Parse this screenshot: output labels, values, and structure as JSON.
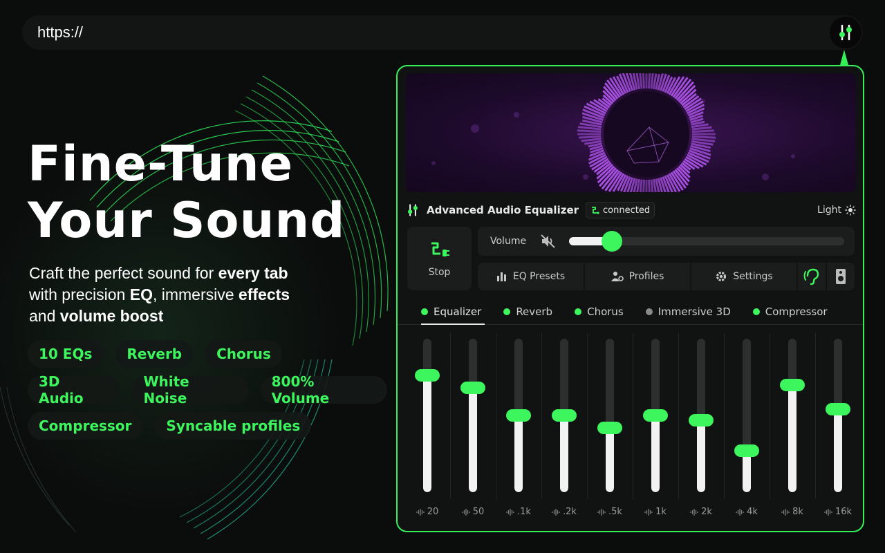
{
  "browser": {
    "url": "https://"
  },
  "hero": {
    "title_line1": "Fine-Tune",
    "title_line2": "Your Sound",
    "sub_1": "Craft the perfect sound for ",
    "sub_2": "every tab",
    "sub_3": "with precision ",
    "sub_4": "EQ",
    "sub_5": ", immersive ",
    "sub_6": "effects",
    "sub_7": "and ",
    "sub_8": "volume boost"
  },
  "features": {
    "row1": [
      "10 EQs",
      "Reverb",
      "Chorus"
    ],
    "row2": [
      "3D Audio",
      "White Noise",
      "800% Volume"
    ],
    "row3": [
      "Compressor",
      "Syncable profiles"
    ]
  },
  "panel": {
    "app_title": "Advanced Audio Equalizer",
    "status": "connected",
    "theme_label": "Light",
    "stop_label": "Stop",
    "volume_label": "Volume",
    "volume_level": 0.155,
    "nav": {
      "eq_presets": "EQ Presets",
      "profiles": "Profiles",
      "settings": "Settings"
    },
    "tabs": [
      {
        "label": "Equalizer",
        "enabled": true,
        "active": true
      },
      {
        "label": "Reverb",
        "enabled": true
      },
      {
        "label": "Chorus",
        "enabled": true
      },
      {
        "label": "Immersive 3D",
        "enabled": false
      },
      {
        "label": "Compressor",
        "enabled": true
      }
    ],
    "eq_bands": [
      {
        "label": "20",
        "level": 0.76
      },
      {
        "label": "50",
        "level": 0.68
      },
      {
        "label": ".1k",
        "level": 0.5
      },
      {
        "label": ".2k",
        "level": 0.5
      },
      {
        "label": ".5k",
        "level": 0.42
      },
      {
        "label": "1k",
        "level": 0.5
      },
      {
        "label": "2k",
        "level": 0.47
      },
      {
        "label": "4k",
        "level": 0.27
      },
      {
        "label": "8k",
        "level": 0.7
      },
      {
        "label": "16k",
        "level": 0.54
      }
    ]
  },
  "colors": {
    "accent": "#3df55d",
    "panel_bg": "#111312",
    "border": "#35f058",
    "viz_purple": "#a64fe0"
  }
}
